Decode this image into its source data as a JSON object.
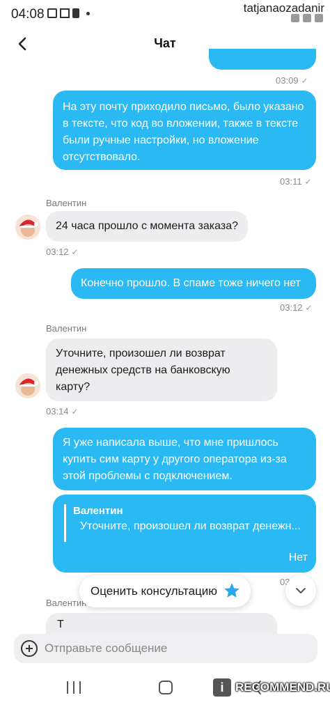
{
  "status_bar": {
    "time": "04:08",
    "username": "tatjanaozadanir"
  },
  "header": {
    "title": "Чат"
  },
  "messages": [
    {
      "time": "03:09"
    },
    {
      "text": "На эту почту приходило письмо, было указано в тексте, что код во вложении, также в тексте были ручные настройки, но вложение отсутствовало.",
      "time": "03:11"
    },
    {
      "sender": "Валентин",
      "text": "24 часа прошло с момента заказа?",
      "time": "03:12"
    },
    {
      "text": "Конечно прошло. В спаме тоже ничего нет",
      "time": "03:12"
    },
    {
      "sender": "Валентин",
      "text": "Уточните, произошел ли возврат денежных средств на банковскую карту?",
      "time": "03:14"
    },
    {
      "text": "Я уже написала выше, что мне пришлось купить сим карту у другого оператора из-за этой проблемы с подключением."
    },
    {
      "quote_sender": "Валентин",
      "quote_text": "Уточните, произошел ли возврат денежн...",
      "reply": "Нет",
      "time": "03:"
    },
    {
      "sender": "Валентин",
      "text": "Т"
    }
  ],
  "rate_button": {
    "label": "Оценить консультацию"
  },
  "composer": {
    "placeholder": "Отправьте сообщение"
  },
  "watermark": {
    "badge": "i",
    "text": "RECOMMEND.RU"
  },
  "colors": {
    "outgoing_bubble": "#2bb9f3",
    "incoming_bubble": "#ededf0",
    "star": "#2aa7e8"
  },
  "icons": {
    "back": "arrow-left-icon",
    "star": "star-icon",
    "scroll": "chevron-down-icon",
    "attach": "plus-circle-icon"
  }
}
